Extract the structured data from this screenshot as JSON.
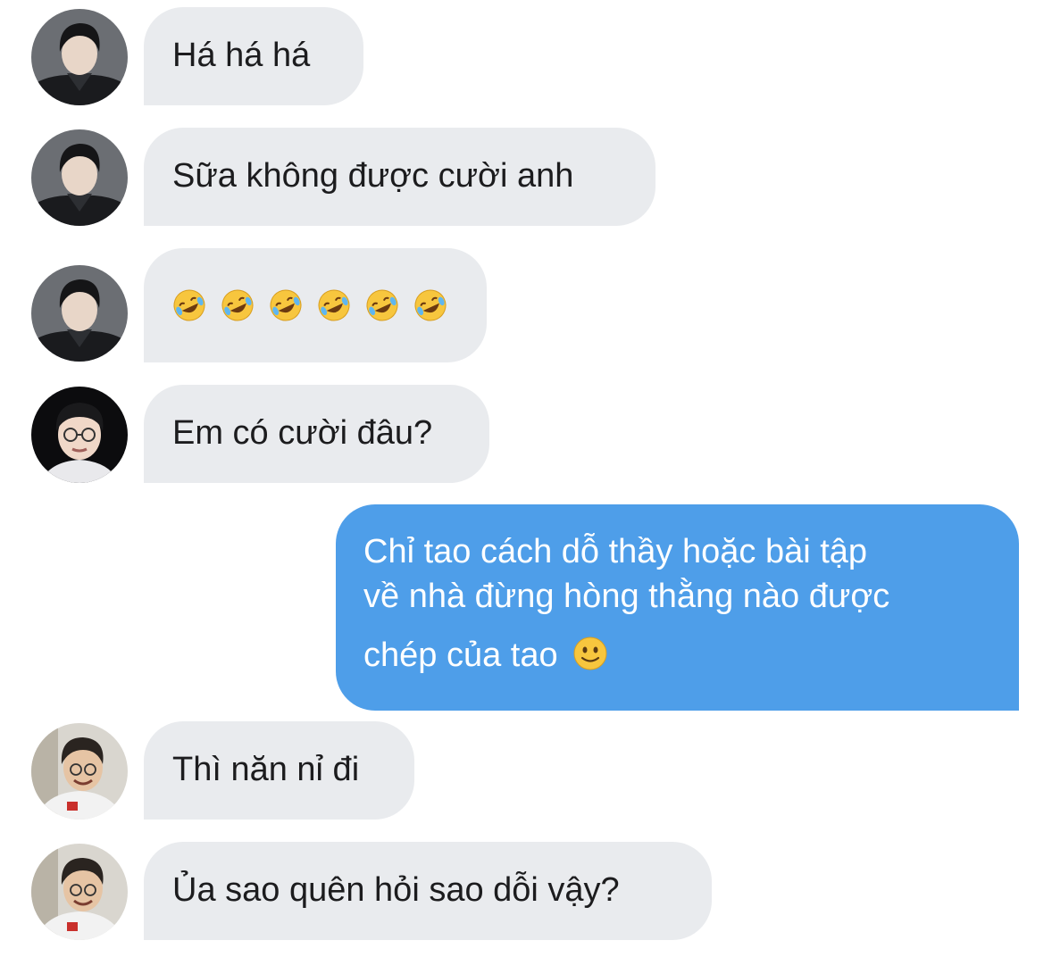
{
  "messages": [
    {
      "sender": "avatar-a",
      "text": "Há há há"
    },
    {
      "sender": "avatar-a",
      "text": "Sữa không được cười anh"
    },
    {
      "sender": "avatar-a",
      "text": "",
      "emoji": [
        "rolling-on-floor-laughing-emoji",
        "rolling-on-floor-laughing-emoji",
        "rolling-on-floor-laughing-emoji",
        "rolling-on-floor-laughing-emoji",
        "rolling-on-floor-laughing-emoji",
        "rolling-on-floor-laughing-emoji"
      ]
    },
    {
      "sender": "avatar-b",
      "text": "Em có cười đâu?"
    },
    {
      "sender": "me",
      "lines": [
        "Chỉ tao cách dỗ thầy hoặc bài tập",
        "về nhà đừng hòng thằng nào được",
        "chép của tao"
      ],
      "trailing_emoji": "slightly-smiling-face-emoji"
    },
    {
      "sender": "avatar-c",
      "text": "Thì năn nỉ đi"
    },
    {
      "sender": "avatar-c",
      "text": "Ủa sao quên hỏi sao dỗi vậy?"
    }
  ],
  "colors": {
    "incoming_bubble": "#e9ebee",
    "outgoing_bubble": "#4e9ee9",
    "incoming_text": "#1c1c1e",
    "outgoing_text": "#ffffff"
  }
}
